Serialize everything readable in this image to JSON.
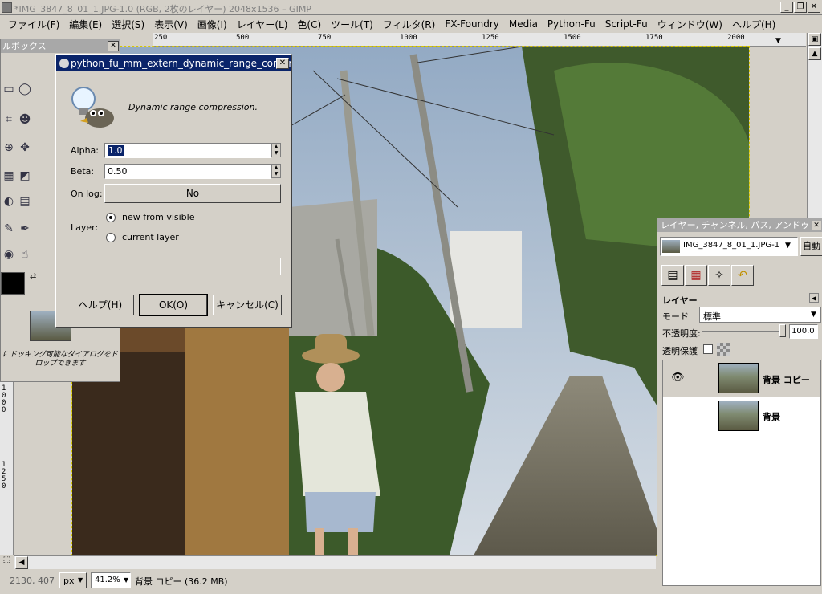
{
  "window": {
    "title": "*IMG_3847_8_01_1.JPG-1.0 (RGB, 2枚のレイヤー) 2048x1536 – GIMP",
    "min": "_",
    "restore": "❐",
    "close": "✕"
  },
  "menu": [
    "ファイル(F)",
    "編集(E)",
    "選択(S)",
    "表示(V)",
    "画像(I)",
    "レイヤー(L)",
    "色(C)",
    "ツール(T)",
    "フィルタ(R)",
    "FX-Foundry",
    "Media",
    "Python-Fu",
    "Script-Fu",
    "ウィンドウ(W)",
    "ヘルプ(H)"
  ],
  "ruler": {
    "h": [
      "250",
      "500",
      "750",
      "1000",
      "1250",
      "1500",
      "1750",
      "2000"
    ],
    "v": [
      "1000",
      "1250"
    ]
  },
  "toolbox": {
    "title": "ルボックス",
    "close": "✕",
    "drop_hint": "にドッキング可能なダイアログをドロップできます"
  },
  "dialog": {
    "title": "python_fu_mm_extern_dynamic_range_compressi...",
    "close": "✕",
    "description": "Dynamic range compression.",
    "alpha_label": "Alpha:",
    "alpha_value": "1.0",
    "beta_label": "Beta:",
    "beta_value": "0.50",
    "onlog_label": "On log:",
    "onlog_value": "No",
    "layer_label": "Layer:",
    "radio_new": "new from visible",
    "radio_current": "current layer",
    "help": "ヘルプ(H)",
    "ok": "OK(O)",
    "cancel": "キャンセル(C)"
  },
  "layers": {
    "title": "レイヤー, チャンネル, パス, アンドゥ",
    "close": "✕",
    "image_select": "IMG_3847_8_01_1.JPG-1",
    "auto": "自動",
    "section": "レイヤー",
    "mode_label": "モード",
    "mode_value": "標準",
    "opacity_label": "不透明度:",
    "opacity_value": "100.0",
    "lock_label": "透明保護",
    "items": [
      {
        "name": "背景 コピー"
      },
      {
        "name": "背景"
      }
    ]
  },
  "status": {
    "coords": "2130, 407",
    "unit": "px",
    "zoom": "41.2%",
    "info": "背景 コピー (36.2 MB)"
  }
}
